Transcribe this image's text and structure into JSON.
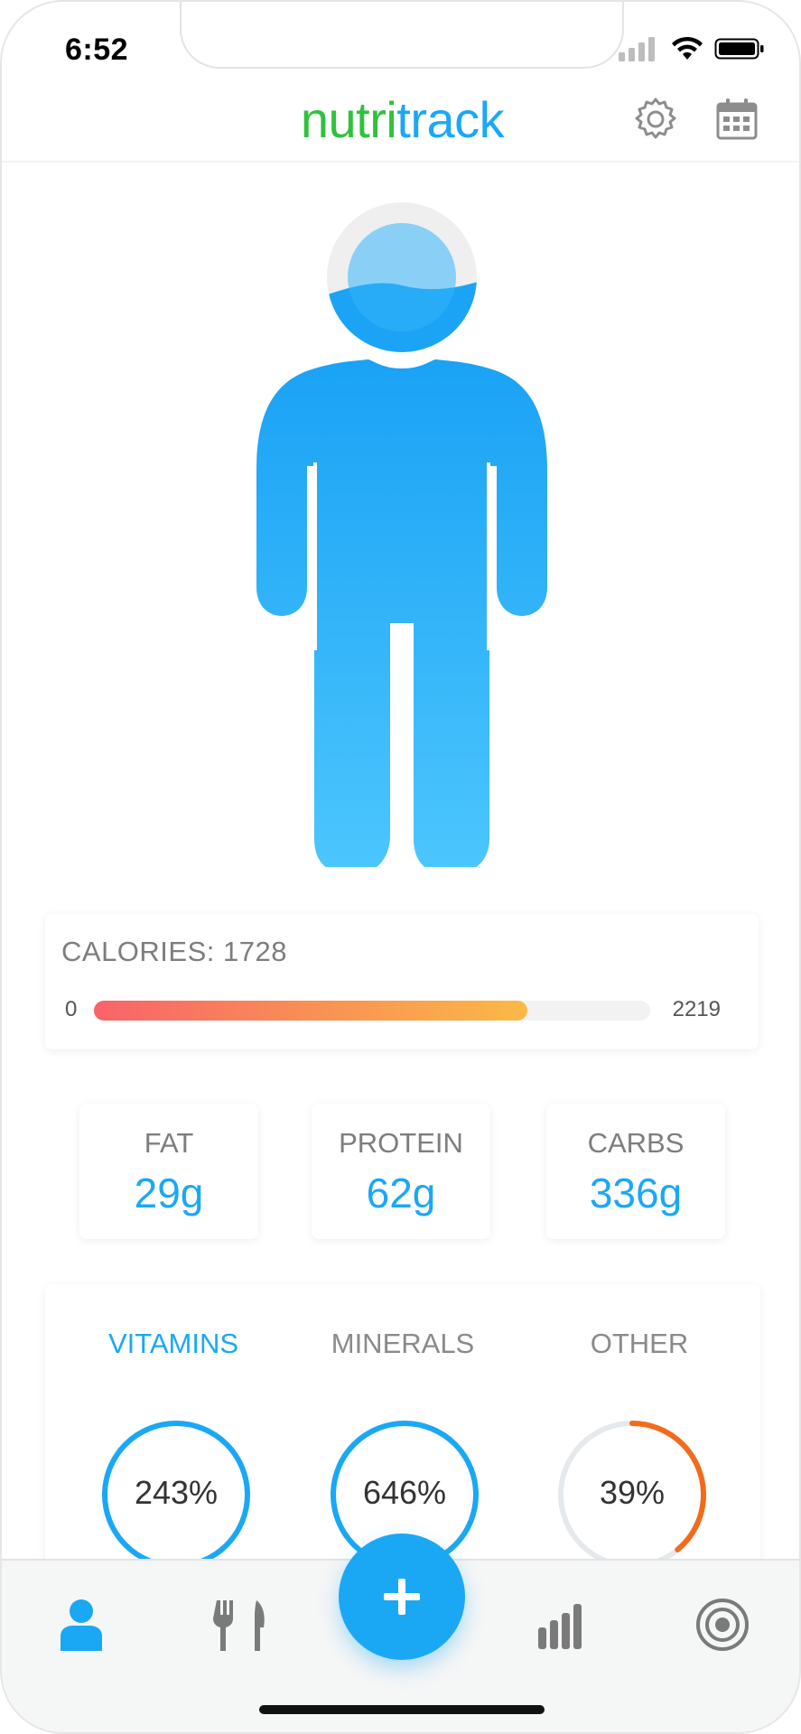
{
  "status_bar": {
    "time": "6:52"
  },
  "header": {
    "logo_part1": "nutri",
    "logo_part2": "track",
    "settings_icon": "gear-icon",
    "calendar_icon": "calendar-icon"
  },
  "calories": {
    "label": "CALORIES: 1728",
    "min": "0",
    "max": "2219",
    "current": 1728,
    "goal": 2219
  },
  "macros": [
    {
      "label": "FAT",
      "value": "29g"
    },
    {
      "label": "PROTEIN",
      "value": "62g"
    },
    {
      "label": "CARBS",
      "value": "336g"
    }
  ],
  "nutrients": {
    "tabs": [
      {
        "label": "VITAMINS",
        "active": true
      },
      {
        "label": "MINERALS",
        "active": false
      },
      {
        "label": "OTHER",
        "active": false
      }
    ],
    "gauges": [
      {
        "text": "243%",
        "percent": 243,
        "color": "#1aa8f5"
      },
      {
        "text": "646%",
        "percent": 646,
        "color": "#1aa8f5"
      },
      {
        "text": "39%",
        "percent": 39,
        "color": "#f26b1d"
      }
    ]
  },
  "body_figure": {
    "head_fill_fraction": 0.55,
    "color": "#1aa8f5"
  },
  "bottom_nav": {
    "items": [
      "person-icon",
      "fork-knife-icon",
      "add-icon",
      "bar-chart-icon",
      "target-icon"
    ],
    "active": "person-icon"
  },
  "colors": {
    "accent": "#1aa8f5",
    "brand_green": "#2fc23c",
    "warning": "#f26b1d"
  }
}
